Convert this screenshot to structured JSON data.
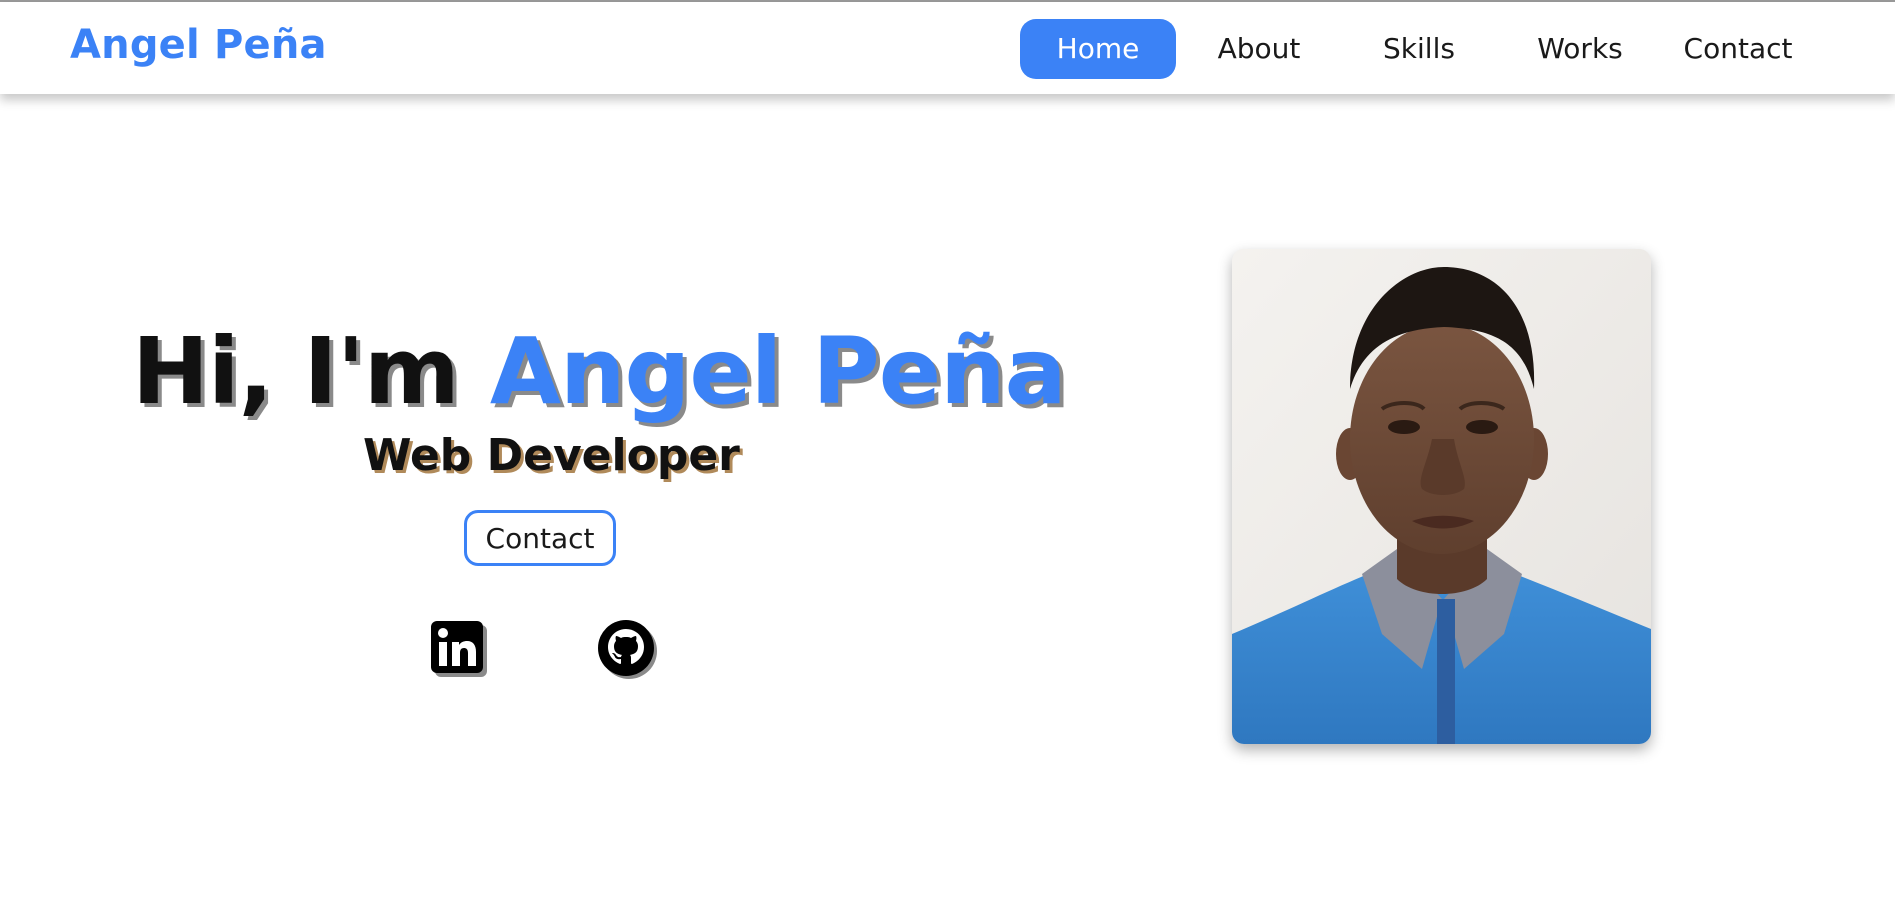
{
  "header": {
    "logo": "Angel Peña",
    "nav": [
      {
        "label": "Home",
        "active": true
      },
      {
        "label": "About",
        "active": false
      },
      {
        "label": "Skills",
        "active": false
      },
      {
        "label": "Works",
        "active": false
      },
      {
        "label": "Contact",
        "active": false
      }
    ]
  },
  "hero": {
    "greeting": "Hi, I'm ",
    "name": "Angel Peña",
    "role": "Web Developer",
    "contact_button": "Contact",
    "social": [
      {
        "icon": "linkedin-icon"
      },
      {
        "icon": "github-icon"
      }
    ]
  },
  "colors": {
    "accent": "#3b82f6",
    "text": "#111111"
  }
}
